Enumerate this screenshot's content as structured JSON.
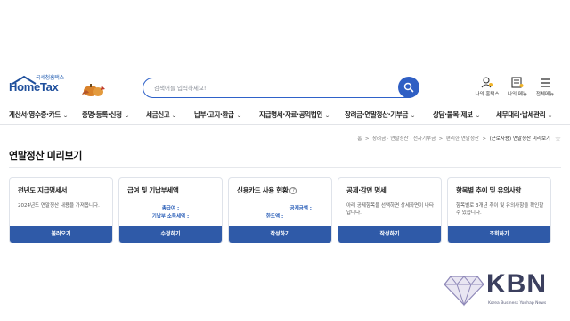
{
  "logo": {
    "sub": "국세청홈택스",
    "main": "HomeTax"
  },
  "search": {
    "placeholder": "검색어를 입력하세요!"
  },
  "utility": [
    {
      "icon": "user-icon",
      "label": "나의 홈택스"
    },
    {
      "icon": "menu-icon",
      "label": "나의 메뉴"
    },
    {
      "icon": "hamburger-icon",
      "label": "전체메뉴"
    }
  ],
  "gnb": [
    "계산서·영수증·카드",
    "증명·등록·신청",
    "세금신고",
    "납부·고지·환급",
    "지급명세·자료·공익법인",
    "장려금·연말정산·기부금",
    "상담·불복·제보",
    "세무대리·납세관리"
  ],
  "breadcrumb": {
    "items": [
      "홈",
      "장려금 · 연말정산 · 전자기부금",
      "편리한 연말정산"
    ],
    "current": "(근로자용) 연말정산 미리보기",
    "separator": ">"
  },
  "page_title": "연말정산 미리보기",
  "cards": [
    {
      "title": "전년도 지급명세서",
      "desc": "2024년도 연말정산 내용을 가져옵니다.",
      "kv": [],
      "button": "불러오기"
    },
    {
      "title": "급여 및 기납부세액",
      "desc": "",
      "kv": [
        "총급여 :",
        "기납부 소득세액 :"
      ],
      "button": "수정하기"
    },
    {
      "title": "신용카드 사용 현황",
      "desc": "",
      "kv": [
        "공제금액 :",
        "한도액 :"
      ],
      "button": "작성하기"
    },
    {
      "title": "공제·감면 명세",
      "desc": "아래 공제항목을 선택하면 상세화면이 나타납니다.",
      "kv": [],
      "button": "작성하기"
    },
    {
      "title": "항목별 추이 및 유의사항",
      "desc": "항목별로 3개년 추이 및 유의사항을 확인할 수 있습니다.",
      "kv": [],
      "button": "조회하기"
    }
  ],
  "watermark": {
    "brand": "KBN",
    "sub": "Korea Business Yonhap News"
  },
  "colors": {
    "primary": "#2f5fc4",
    "button": "#2f5aa8",
    "text": "#222222"
  }
}
